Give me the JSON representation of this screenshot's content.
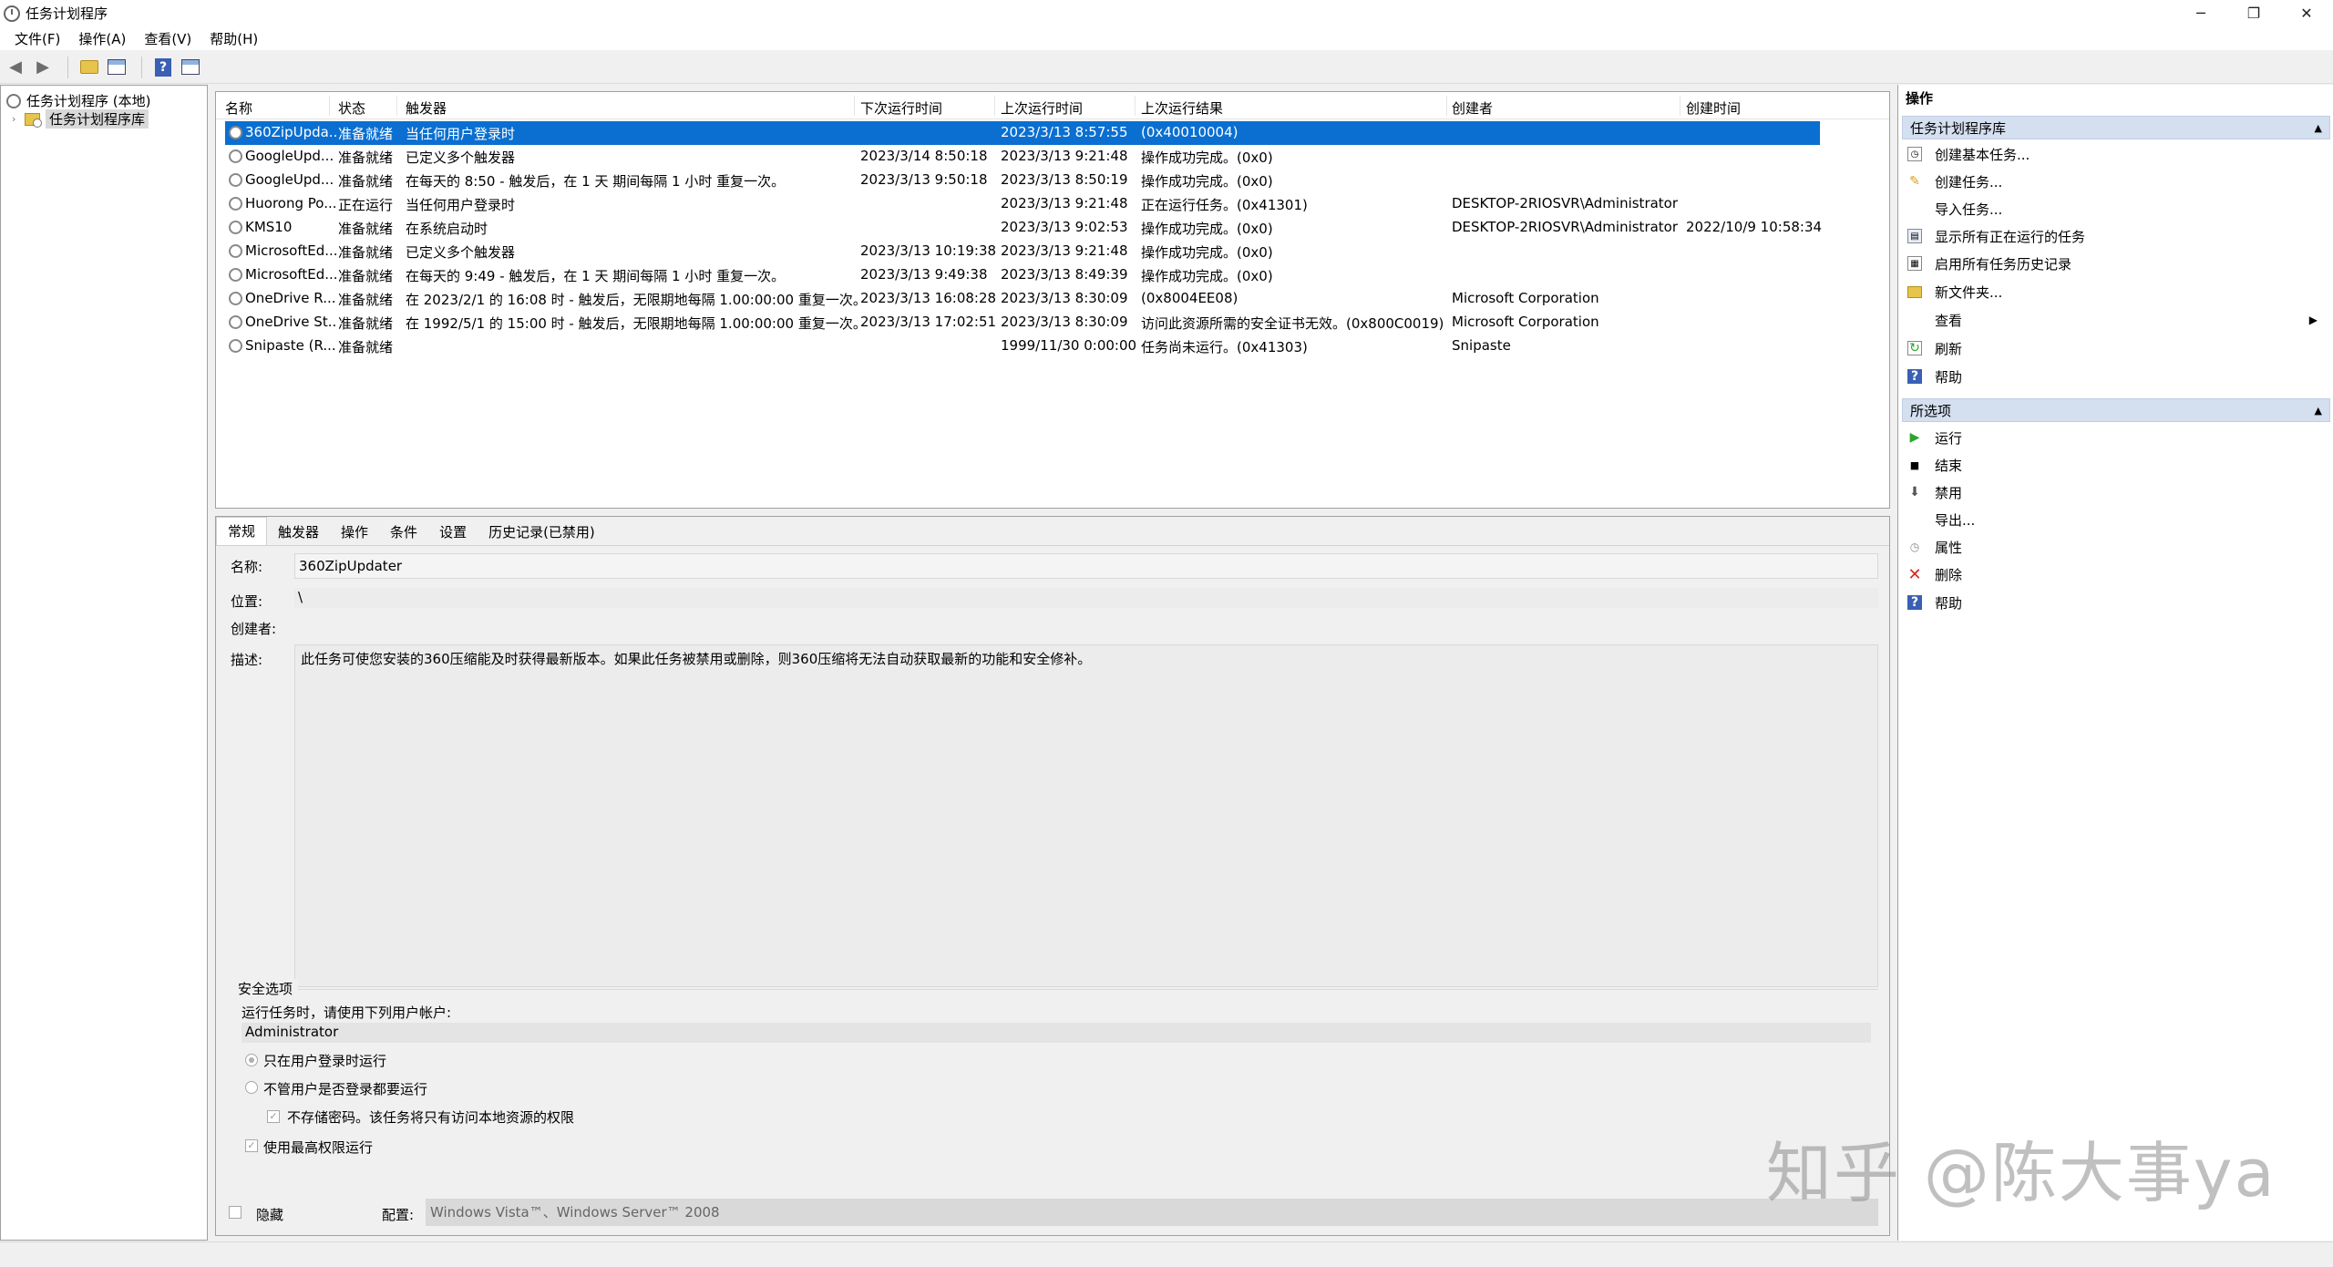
{
  "window": {
    "title": "任务计划程序",
    "controls": {
      "minimize": "─",
      "restore": "❐",
      "close": "✕"
    }
  },
  "menu": [
    "文件(F)",
    "操作(A)",
    "查看(V)",
    "帮助(H)"
  ],
  "tree": {
    "root": "任务计划程序 (本地)",
    "library": "任务计划程序库"
  },
  "columns": [
    "名称",
    "状态",
    "触发器",
    "下次运行时间",
    "上次运行时间",
    "上次运行结果",
    "创建者",
    "创建时间"
  ],
  "tasks": [
    {
      "name": "360ZipUpda...",
      "status": "准备就绪",
      "trigger": "当任何用户登录时",
      "next": "",
      "last": "2023/3/13 8:57:55",
      "result": "(0x40010004)",
      "author": "",
      "created": ""
    },
    {
      "name": "GoogleUpd...",
      "status": "准备就绪",
      "trigger": "已定义多个触发器",
      "next": "2023/3/14 8:50:18",
      "last": "2023/3/13 9:21:48",
      "result": "操作成功完成。(0x0)",
      "author": "",
      "created": ""
    },
    {
      "name": "GoogleUpd...",
      "status": "准备就绪",
      "trigger": "在每天的 8:50 - 触发后，在 1 天 期间每隔 1 小时 重复一次。",
      "next": "2023/3/13 9:50:18",
      "last": "2023/3/13 8:50:19",
      "result": "操作成功完成。(0x0)",
      "author": "",
      "created": ""
    },
    {
      "name": "Huorong Po...",
      "status": "正在运行",
      "trigger": "当任何用户登录时",
      "next": "",
      "last": "2023/3/13 9:21:48",
      "result": "正在运行任务。(0x41301)",
      "author": "DESKTOP-2RIOSVR\\Administrator",
      "created": ""
    },
    {
      "name": "KMS10",
      "status": "准备就绪",
      "trigger": "在系统启动时",
      "next": "",
      "last": "2023/3/13 9:02:53",
      "result": "操作成功完成。(0x0)",
      "author": "DESKTOP-2RIOSVR\\Administrator",
      "created": "2022/10/9 10:58:34"
    },
    {
      "name": "MicrosoftEd...",
      "status": "准备就绪",
      "trigger": "已定义多个触发器",
      "next": "2023/3/13 10:19:38",
      "last": "2023/3/13 9:21:48",
      "result": "操作成功完成。(0x0)",
      "author": "",
      "created": ""
    },
    {
      "name": "MicrosoftEd...",
      "status": "准备就绪",
      "trigger": "在每天的 9:49 - 触发后，在 1 天 期间每隔 1 小时 重复一次。",
      "next": "2023/3/13 9:49:38",
      "last": "2023/3/13 8:49:39",
      "result": "操作成功完成。(0x0)",
      "author": "",
      "created": ""
    },
    {
      "name": "OneDrive R...",
      "status": "准备就绪",
      "trigger": "在 2023/2/1 的 16:08 时 - 触发后，无限期地每隔 1.00:00:00 重复一次。",
      "next": "2023/3/13 16:08:28",
      "last": "2023/3/13 8:30:09",
      "result": "(0x8004EE08)",
      "author": "Microsoft Corporation",
      "created": ""
    },
    {
      "name": "OneDrive St...",
      "status": "准备就绪",
      "trigger": "在 1992/5/1 的 15:00 时 - 触发后，无限期地每隔 1.00:00:00 重复一次。",
      "next": "2023/3/13 17:02:51",
      "last": "2023/3/13 8:30:09",
      "result": "访问此资源所需的安全证书无效。(0x800C0019)",
      "author": "Microsoft Corporation",
      "created": ""
    },
    {
      "name": "Snipaste (R...",
      "status": "准备就绪",
      "trigger": "",
      "next": "",
      "last": "1999/11/30 0:00:00",
      "result": "任务尚未运行。(0x41303)",
      "author": "Snipaste",
      "created": ""
    }
  ],
  "detail_tabs": [
    "常规",
    "触发器",
    "操作",
    "条件",
    "设置",
    "历史记录(已禁用)"
  ],
  "detail": {
    "name_label": "名称:",
    "name_value": "360ZipUpdater",
    "location_label": "位置:",
    "location_value": "\\",
    "author_label": "创建者:",
    "author_value": "",
    "desc_label": "描述:",
    "desc_value": "此任务可使您安装的360压缩能及时获得最新版本。如果此任务被禁用或删除，则360压缩将无法自动获取最新的功能和安全修补。",
    "security_title": "安全选项",
    "run_as_label": "运行任务时，请使用下列用户帐户:",
    "run_as_value": "Administrator",
    "opt_logged_on": "只在用户登录时运行",
    "opt_whether": "不管用户是否登录都要运行",
    "opt_no_password": "不存储密码。该任务将只有访问本地资源的权限",
    "opt_highest": "使用最高权限运行",
    "hidden_label": "隐藏",
    "config_label": "配置:",
    "config_value": "Windows Vista™、Windows Server™ 2008"
  },
  "actions": {
    "header": "操作",
    "group1": "任务计划程序库",
    "group1_items": [
      "创建基本任务...",
      "创建任务...",
      "导入任务...",
      "显示所有正在运行的任务",
      "启用所有任务历史记录",
      "新文件夹...",
      "查看",
      "刷新",
      "帮助"
    ],
    "group2": "所选项",
    "group2_items": [
      "运行",
      "结束",
      "禁用",
      "导出...",
      "属性",
      "删除",
      "帮助"
    ]
  },
  "watermark": "知乎 @陈大事ya",
  "colors": {
    "selection": "#0a6fd0",
    "group_header": "#d4dff0",
    "delete_red": "#d9261c",
    "run_green": "#2aa52a"
  }
}
